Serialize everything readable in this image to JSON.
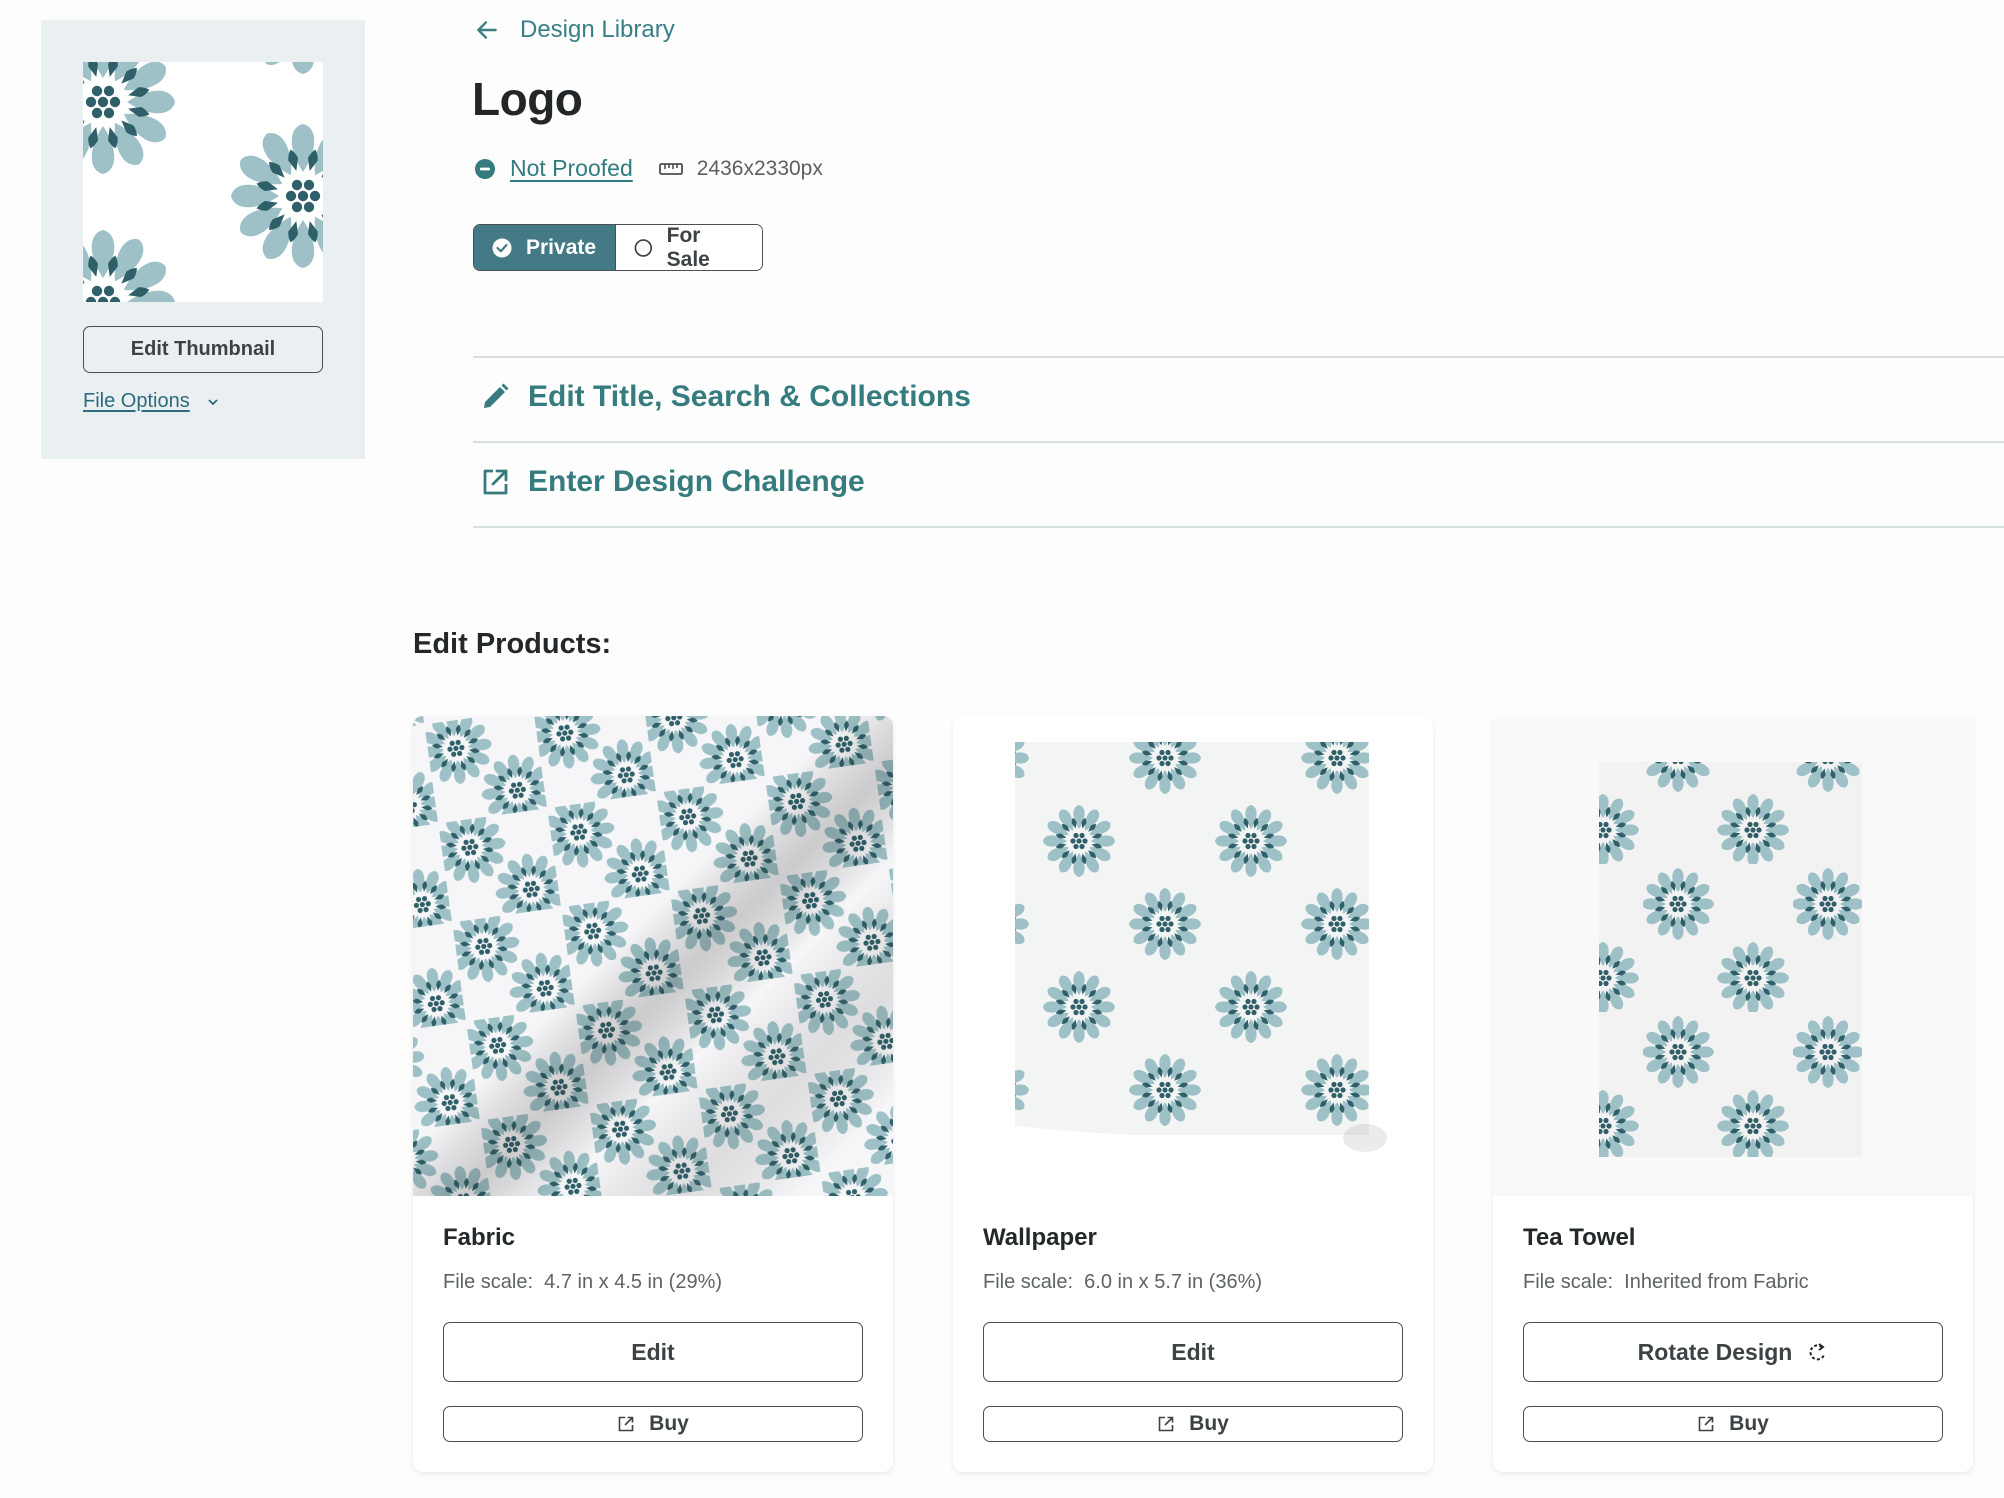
{
  "sidebar": {
    "edit_thumbnail_label": "Edit Thumbnail",
    "file_options_label": "File Options"
  },
  "header": {
    "back_label": "Design Library",
    "title": "Logo",
    "proof_status": "Not Proofed",
    "dimensions": "2436x2330px"
  },
  "visibility": {
    "options": [
      {
        "label": "Private",
        "selected": true
      },
      {
        "label": "For Sale",
        "selected": false
      }
    ]
  },
  "actions": [
    {
      "label": "Edit Title, Search & Collections",
      "icon": "pencil-icon"
    },
    {
      "label": "Enter Design Challenge",
      "icon": "external-link-icon"
    }
  ],
  "products_section": {
    "title": "Edit Products:",
    "products": [
      {
        "name": "Fabric",
        "scale_label": "File scale:",
        "scale_value": "4.7 in x 4.5 in (29%)",
        "primary_label": "Edit",
        "primary_icon": "",
        "buy_label": "Buy"
      },
      {
        "name": "Wallpaper",
        "scale_label": "File scale:",
        "scale_value": "6.0 in x 5.7 in (36%)",
        "primary_label": "Edit",
        "primary_icon": "",
        "buy_label": "Buy"
      },
      {
        "name": "Tea Towel",
        "scale_label": "File scale:",
        "scale_value": "Inherited from Fabric",
        "primary_label": "Rotate Design",
        "primary_icon": "rotate-icon",
        "buy_label": "Buy"
      }
    ]
  },
  "colors": {
    "accent": "#447a86",
    "link": "#327c80",
    "petal_light": "#9dc1c6",
    "petal_dark": "#2f5f68",
    "sidebar_bg": "#eaf0f1"
  }
}
